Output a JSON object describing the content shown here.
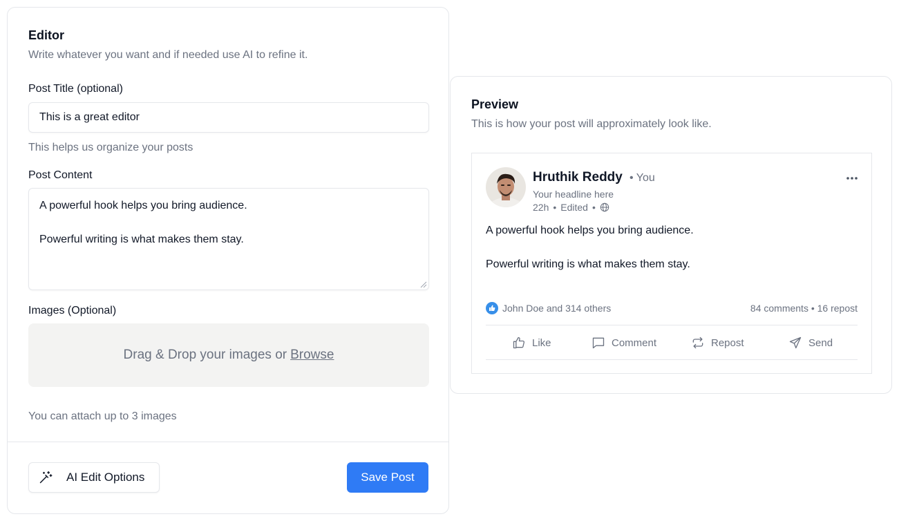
{
  "editor": {
    "title": "Editor",
    "subtitle": "Write whatever you want and if needed use AI to refine it.",
    "post_title_label": "Post Title (optional)",
    "post_title_value": "This is a great editor",
    "post_title_hint": "This helps us organize your posts",
    "post_content_label": "Post Content",
    "post_content_lines": [
      "A powerful hook helps you bring audience.",
      "Powerful writing is what makes them stay."
    ],
    "images_label": "Images (Optional)",
    "dropzone_text": "Drag & Drop your images or",
    "dropzone_link": "Browse",
    "images_hint": "You can attach up to 3 images",
    "ai_button_label": "AI Edit Options",
    "save_button_label": "Save Post"
  },
  "preview": {
    "title": "Preview",
    "subtitle": "This is how your post will approximately look like.",
    "post": {
      "author": "Hruthik Reddy",
      "you_tag": "• You",
      "headline": "Your headline here",
      "time": "22h",
      "edited": "Edited",
      "body_lines": [
        "A powerful hook helps you bring audience.",
        "Powerful writing is what makes them stay."
      ],
      "reactions": "John Doe and 314 others",
      "comments_reposts": "84 comments • 16 repost",
      "actions": {
        "like": "Like",
        "comment": "Comment",
        "repost": "Repost",
        "send": "Send"
      }
    }
  },
  "colors": {
    "accent": "#2f7bf5",
    "like_badge": "#378fe9"
  },
  "icons": [
    "wand-icon",
    "more-icon",
    "globe-icon",
    "like-badge-icon",
    "thumbs-up-icon",
    "comment-icon",
    "repost-icon",
    "send-icon"
  ]
}
